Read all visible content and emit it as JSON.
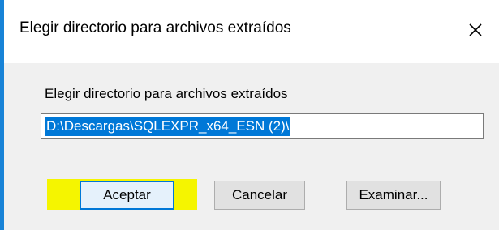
{
  "dialog": {
    "title": "Elegir directorio para archivos extraídos",
    "close_label": "×"
  },
  "directory": {
    "label": "Elegir directorio para archivos extraídos",
    "value": "D:\\Descargas\\SQLEXPR_x64_ESN (2)\\"
  },
  "buttons": {
    "accept": "Aceptar",
    "cancel": "Cancelar",
    "browse": "Examinar..."
  },
  "colors": {
    "accent": "#0078d7",
    "highlight": "#f5f500",
    "window_border": "#1883d7"
  }
}
